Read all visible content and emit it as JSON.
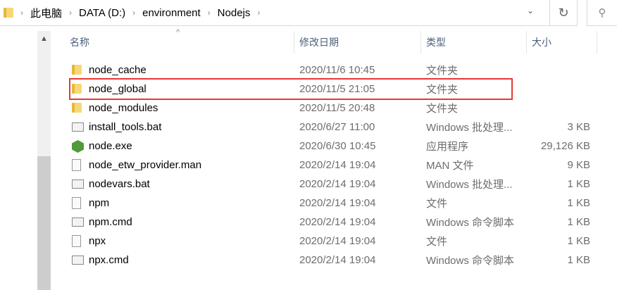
{
  "breadcrumb": [
    "此电脑",
    "DATA (D:)",
    "environment",
    "Nodejs"
  ],
  "columns": {
    "name": "名称",
    "date": "修改日期",
    "type": "类型",
    "size": "大小"
  },
  "files": [
    {
      "name": "node_cache",
      "date": "2020/11/6 10:45",
      "type": "文件夹",
      "size": "",
      "icon": "folder"
    },
    {
      "name": "node_global",
      "date": "2020/11/5 21:05",
      "type": "文件夹",
      "size": "",
      "icon": "folder"
    },
    {
      "name": "node_modules",
      "date": "2020/11/5 20:48",
      "type": "文件夹",
      "size": "",
      "icon": "folder"
    },
    {
      "name": "install_tools.bat",
      "date": "2020/6/27 11:00",
      "type": "Windows 批处理...",
      "size": "3 KB",
      "icon": "bat"
    },
    {
      "name": "node.exe",
      "date": "2020/6/30 10:45",
      "type": "应用程序",
      "size": "29,126 KB",
      "icon": "exe"
    },
    {
      "name": "node_etw_provider.man",
      "date": "2020/2/14 19:04",
      "type": "MAN 文件",
      "size": "9 KB",
      "icon": "doc"
    },
    {
      "name": "nodevars.bat",
      "date": "2020/2/14 19:04",
      "type": "Windows 批处理...",
      "size": "1 KB",
      "icon": "bat"
    },
    {
      "name": "npm",
      "date": "2020/2/14 19:04",
      "type": "文件",
      "size": "1 KB",
      "icon": "doc"
    },
    {
      "name": "npm.cmd",
      "date": "2020/2/14 19:04",
      "type": "Windows 命令脚本",
      "size": "1 KB",
      "icon": "bat"
    },
    {
      "name": "npx",
      "date": "2020/2/14 19:04",
      "type": "文件",
      "size": "1 KB",
      "icon": "doc"
    },
    {
      "name": "npx.cmd",
      "date": "2020/2/14 19:04",
      "type": "Windows 命令脚本",
      "size": "1 KB",
      "icon": "bat"
    }
  ],
  "highlight_color": "#e53935"
}
